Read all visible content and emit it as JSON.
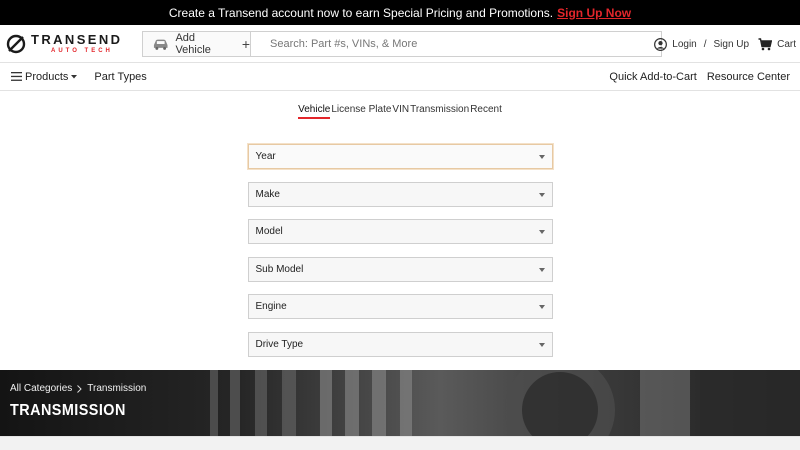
{
  "promo": {
    "text": "Create a Transend account now to earn Special Pricing and Promotions.",
    "link": "Sign Up Now"
  },
  "header": {
    "brand": "TRANSEND",
    "brand_sub": "AUTO TECH",
    "add_vehicle": "Add Vehicle",
    "search_placeholder": "Search: Part #s, VINs, & More",
    "login": "Login",
    "separator": "/",
    "signup": "Sign Up",
    "cart": "Cart"
  },
  "nav": {
    "products": "Products",
    "part_types": "Part Types",
    "quick_add": "Quick Add-to-Cart",
    "resource_center": "Resource Center"
  },
  "selector": {
    "tabs": [
      "Vehicle",
      "License Plate",
      "VIN",
      "Transmission",
      "Recent"
    ],
    "active_tab": "Vehicle",
    "fields": [
      "Year",
      "Make",
      "Model",
      "Sub Model",
      "Engine",
      "Drive Type"
    ]
  },
  "hero": {
    "breadcrumb": [
      "All Categories",
      "Transmission"
    ],
    "title": "TRANSMISSION"
  },
  "colors": {
    "accent": "#e3262b",
    "promo_bg": "#000000"
  }
}
